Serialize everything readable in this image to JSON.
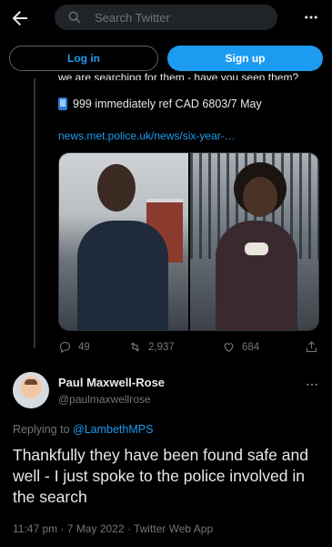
{
  "search": {
    "placeholder": "Search Twitter"
  },
  "auth": {
    "login_label": "Log in",
    "signup_label": "Sign up"
  },
  "quoted": {
    "cut_text": "we are searching for them - have you seen them?",
    "phone_line": "999 immediately ref CAD 6803/7 May",
    "link": "news.met.police.uk/news/six-year-…",
    "stats": {
      "replies": "49",
      "retweets": "2,937",
      "likes": "684"
    }
  },
  "tweet": {
    "author_name": "Paul Maxwell-Rose",
    "author_handle": "@paulmaxwellrose",
    "replying_prefix": "Replying to ",
    "replying_to": "@LambethMPS",
    "text": "Thankfully they have been found safe and well - I just spoke to the police involved in the search",
    "meta": "11:47 pm · 7 May 2022 · Twitter Web App"
  },
  "colors": {
    "accent": "#1d9bf0",
    "muted": "#71767b",
    "text": "#e7e9ea",
    "background": "#000000"
  },
  "icons": [
    "back-arrow-icon",
    "search-icon",
    "more-icon",
    "phone-emoji-icon",
    "reply-icon",
    "retweet-icon",
    "like-icon",
    "share-icon"
  ]
}
